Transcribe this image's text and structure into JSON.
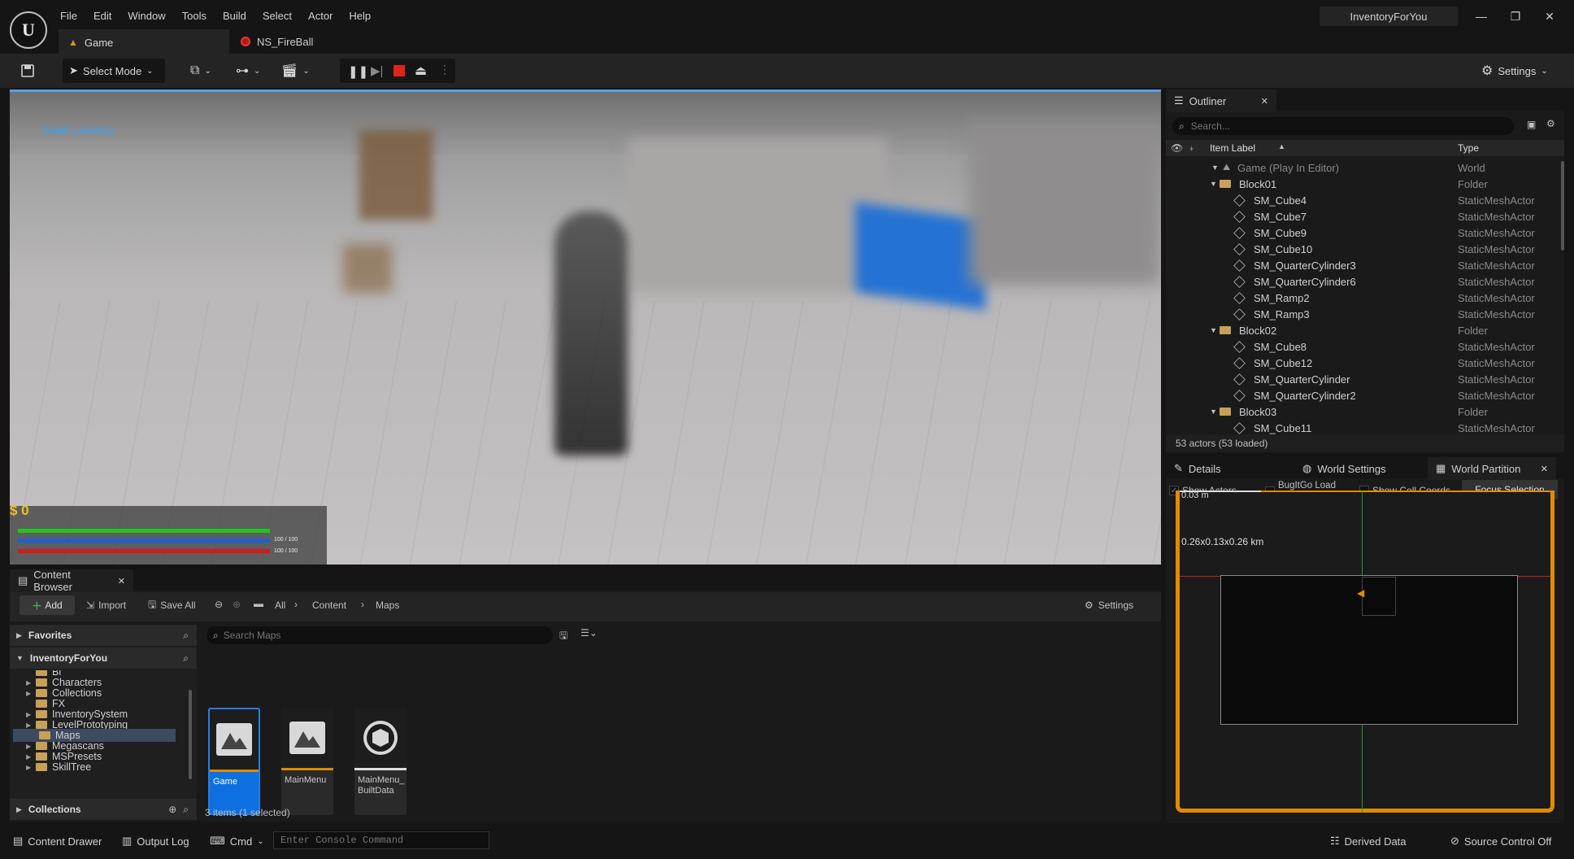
{
  "app": {
    "project": "InventoryForYou",
    "logo_letter": "U"
  },
  "menu": [
    "File",
    "Edit",
    "Window",
    "Tools",
    "Build",
    "Select",
    "Actor",
    "Help"
  ],
  "tabs": [
    {
      "label": "Game"
    },
    {
      "label": "NS_FireBall"
    }
  ],
  "toolbar": {
    "select_mode": "Select Mode",
    "settings": "Settings"
  },
  "viewport": {
    "status": "GAME LOADED",
    "money": "$ 0",
    "health": "100 / 100",
    "stamina": "100 / 100",
    "colors": {
      "health": "#23c41f",
      "stamina": "#1f5fd6",
      "mana": "#d21c1c"
    }
  },
  "outliner": {
    "title": "Outliner",
    "search_placeholder": "Search...",
    "col_label": "Item Label",
    "col_type": "Type",
    "root": {
      "label": "Game (Play In Editor)",
      "type": "World"
    },
    "rows": [
      {
        "label": "Block01",
        "type": "Folder",
        "folder": true,
        "indent": 1
      },
      {
        "label": "SM_Cube4",
        "type": "StaticMeshActor",
        "indent": 2
      },
      {
        "label": "SM_Cube7",
        "type": "StaticMeshActor",
        "indent": 2
      },
      {
        "label": "SM_Cube9",
        "type": "StaticMeshActor",
        "indent": 2
      },
      {
        "label": "SM_Cube10",
        "type": "StaticMeshActor",
        "indent": 2
      },
      {
        "label": "SM_QuarterCylinder3",
        "type": "StaticMeshActor",
        "indent": 2
      },
      {
        "label": "SM_QuarterCylinder6",
        "type": "StaticMeshActor",
        "indent": 2
      },
      {
        "label": "SM_Ramp2",
        "type": "StaticMeshActor",
        "indent": 2
      },
      {
        "label": "SM_Ramp3",
        "type": "StaticMeshActor",
        "indent": 2
      },
      {
        "label": "Block02",
        "type": "Folder",
        "folder": true,
        "indent": 1
      },
      {
        "label": "SM_Cube8",
        "type": "StaticMeshActor",
        "indent": 2
      },
      {
        "label": "SM_Cube12",
        "type": "StaticMeshActor",
        "indent": 2
      },
      {
        "label": "SM_QuarterCylinder",
        "type": "StaticMeshActor",
        "indent": 2
      },
      {
        "label": "SM_QuarterCylinder2",
        "type": "StaticMeshActor",
        "indent": 2
      },
      {
        "label": "Block03",
        "type": "Folder",
        "folder": true,
        "indent": 1
      },
      {
        "label": "SM_Cube11",
        "type": "StaticMeshActor",
        "indent": 2
      }
    ],
    "footer": "53 actors (53 loaded)"
  },
  "details_tabs": [
    {
      "label": "Details"
    },
    {
      "label": "World Settings"
    },
    {
      "label": "World Partition"
    }
  ],
  "world_partition": {
    "show_actors": "Show Actors",
    "bugitgo": "BugItGo Load Cells",
    "show_cell_coords": "Show Cell Coords",
    "focus_selection": "Focus Selection",
    "scale": "0.03 m",
    "size": "0.26x0.13x0.26 km"
  },
  "content_browser": {
    "title": "Content Browser",
    "add": "Add",
    "import": "Import",
    "save_all": "Save All",
    "breadcrumb": [
      "All",
      "Content",
      "Maps"
    ],
    "settings": "Settings",
    "favorites": "Favorites",
    "project_root": "InventoryForYou",
    "tree": [
      "Bl",
      "Characters",
      "Collections",
      "FX",
      "InventorySystem",
      "LevelPrototyping",
      "Maps",
      "Megascans",
      "MSPresets",
      "SkillTree"
    ],
    "collections": "Collections",
    "search_placeholder": "Search Maps",
    "assets": [
      {
        "name": "Game",
        "selected": true
      },
      {
        "name": "MainMenu"
      },
      {
        "name": "MainMenu_ BuiltData"
      }
    ],
    "count": "3 items (1 selected)"
  },
  "status": {
    "content_drawer": "Content Drawer",
    "output_log": "Output Log",
    "cmd": "Cmd",
    "console_placeholder": "Enter Console Command",
    "derived_data": "Derived Data",
    "source_control": "Source Control Off"
  }
}
